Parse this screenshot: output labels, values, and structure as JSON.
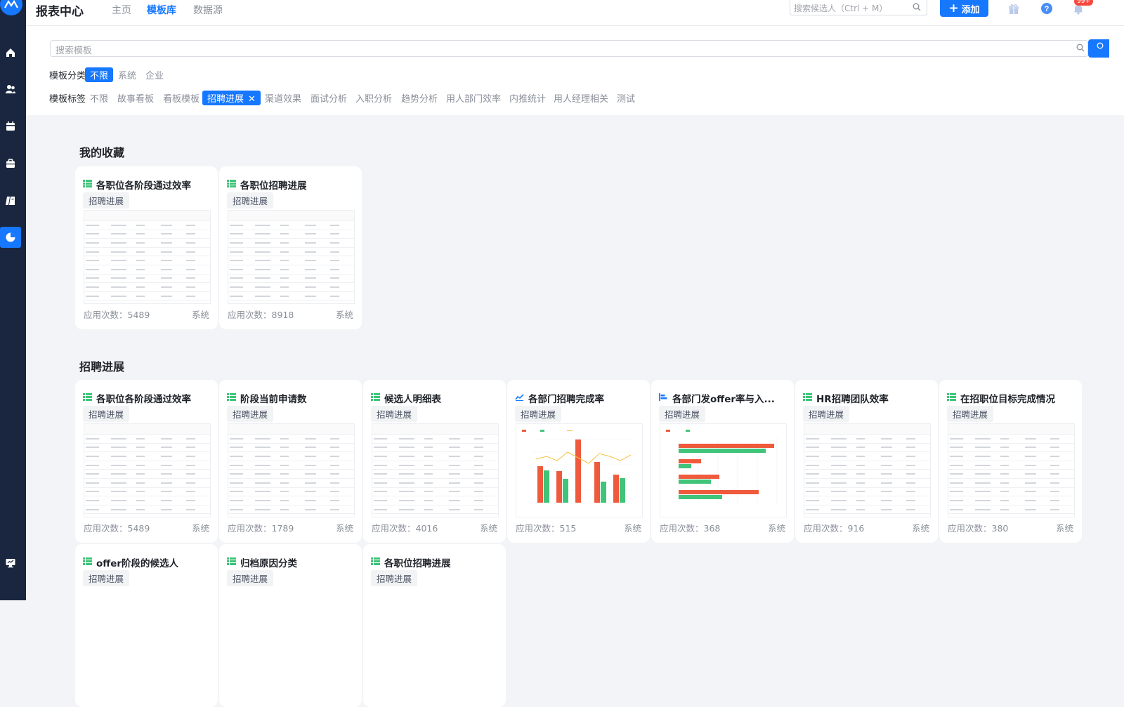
{
  "app": {
    "title": "报表中心",
    "logo_icon": "app-logo-icon"
  },
  "nav": {
    "tabs": [
      {
        "label": "主页"
      },
      {
        "label": "模板库"
      },
      {
        "label": "数据源"
      }
    ],
    "active_index": 1
  },
  "header": {
    "candidate_search_placeholder": "搜索候选人（Ctrl + M）",
    "add_label": "添加",
    "notification_badge": "99+",
    "icons": [
      "gift-icon",
      "help-icon",
      "bell-icon"
    ]
  },
  "sidebar": {
    "items": [
      {
        "icon": "home-icon"
      },
      {
        "icon": "people-icon"
      },
      {
        "icon": "calendar-icon"
      },
      {
        "icon": "briefcase-icon"
      },
      {
        "icon": "book-icon"
      },
      {
        "icon": "report-pie-icon",
        "active": true
      }
    ],
    "bottom_icon": "monitor-icon"
  },
  "filter": {
    "search_placeholder": "搜索模板",
    "category": {
      "label": "模板分类",
      "options": [
        "不限",
        "系统",
        "企业"
      ],
      "selected": 0
    },
    "tags": {
      "label": "模板标签",
      "options": [
        "不限",
        "故事看板",
        "看板模板",
        "招聘进展",
        "渠道效果",
        "面试分析",
        "入职分析",
        "趋势分析",
        "用人部门效率",
        "内推统计",
        "用人经理相关",
        "测试"
      ],
      "selected": 3
    }
  },
  "favorites": {
    "title": "我的收藏",
    "cards": [
      {
        "title": "各职位各阶段通过效率",
        "tag": "招聘进展",
        "uses_label": "应用次数：",
        "uses": "5489",
        "source": "系统",
        "icon": "table-icon",
        "thumb": "table"
      },
      {
        "title": "各职位招聘进展",
        "tag": "招聘进展",
        "uses_label": "应用次数：",
        "uses": "8918",
        "source": "系统",
        "icon": "table-icon",
        "thumb": "table"
      }
    ]
  },
  "progress": {
    "title": "招聘进展",
    "cards": [
      {
        "title": "各职位各阶段通过效率",
        "tag": "招聘进展",
        "uses_label": "应用次数：",
        "uses": "5489",
        "source": "系统",
        "icon": "table-icon",
        "thumb": "table"
      },
      {
        "title": "阶段当前申请数",
        "tag": "招聘进展",
        "uses_label": "应用次数：",
        "uses": "1789",
        "source": "系统",
        "icon": "table-icon",
        "thumb": "table"
      },
      {
        "title": "候选人明细表",
        "tag": "招聘进展",
        "uses_label": "应用次数：",
        "uses": "4016",
        "source": "系统",
        "icon": "table-icon",
        "thumb": "table"
      },
      {
        "title": "各部门招聘完成率",
        "tag": "招聘进展",
        "uses_label": "应用次数：",
        "uses": "515",
        "source": "系统",
        "icon": "line-chart-icon",
        "thumb": "combo"
      },
      {
        "title": "各部门发offer率与入...",
        "tag": "招聘进展",
        "uses_label": "应用次数：",
        "uses": "368",
        "source": "系统",
        "icon": "bar-chart-icon",
        "thumb": "hbar"
      },
      {
        "title": "HR招聘团队效率",
        "tag": "招聘进展",
        "uses_label": "应用次数：",
        "uses": "916",
        "source": "系统",
        "icon": "table-icon",
        "thumb": "table"
      },
      {
        "title": "在招职位目标完成情况",
        "tag": "招聘进展",
        "uses_label": "应用次数：",
        "uses": "380",
        "source": "系统",
        "icon": "table-icon",
        "thumb": "table"
      },
      {
        "title": "offer阶段的候选人",
        "tag": "招聘进展",
        "icon": "table-icon",
        "thumb": "none"
      },
      {
        "title": "归档原因分类",
        "tag": "招聘进展",
        "icon": "table-icon",
        "thumb": "none"
      },
      {
        "title": "各职位招聘进展",
        "tag": "招聘进展",
        "icon": "table-icon",
        "thumb": "none"
      }
    ]
  },
  "colors": {
    "primary": "#1677ff",
    "sidebar": "#1a2640",
    "bar_red": "#f05a3c",
    "bar_green": "#3fc47a",
    "line_yellow": "#f5c242"
  }
}
